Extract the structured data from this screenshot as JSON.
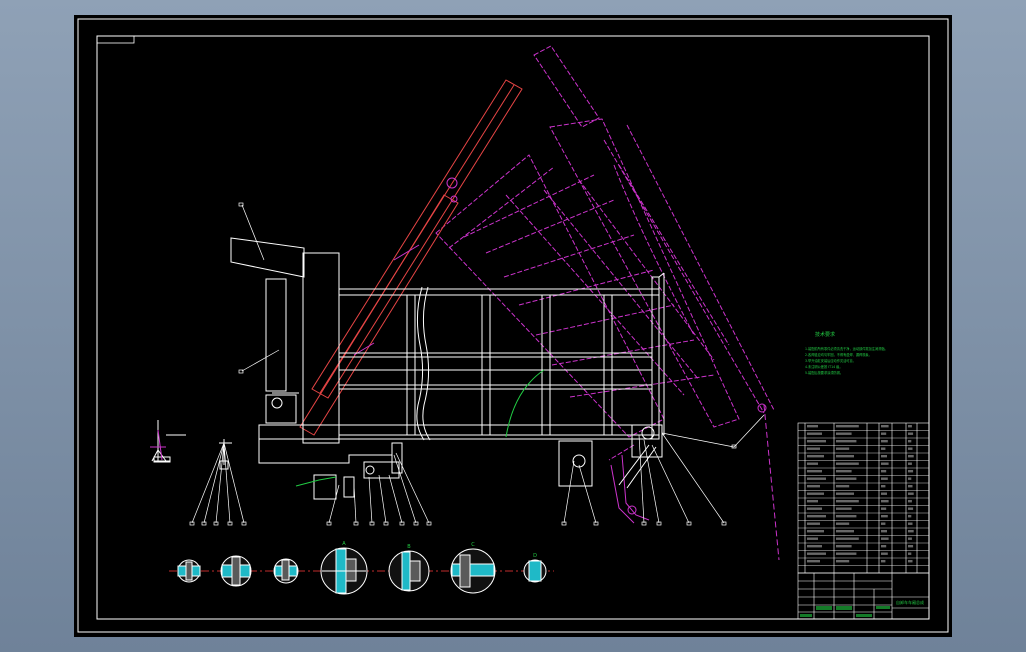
{
  "colors": {
    "background": "#000000",
    "frame": "#ffffff",
    "raised_body": "#cc33cc",
    "hydraulic_cylinder": "#e64545",
    "notes": "#22cc44",
    "section_hatch": "#1fb9c7",
    "section_fill": "#5a5a5a",
    "centerline": "#ff3b3b"
  },
  "notes": {
    "title": "技术要求",
    "lines": [
      "1.装配前所有零件必须清洗干净，运动部件需加注润滑脂。",
      "2.各焊缝应均匀牢固，不得有虚焊、漏焊现象。",
      "3.举升油缸安装后应动作灵活可靠。",
      "4.未注明公差按 IT14 级。",
      "5.装配后按要求涂漆防锈。"
    ]
  },
  "title_block": {
    "title": "自卸车车厢总成"
  },
  "detail_labels": [
    "A",
    "B",
    "C",
    "D"
  ]
}
